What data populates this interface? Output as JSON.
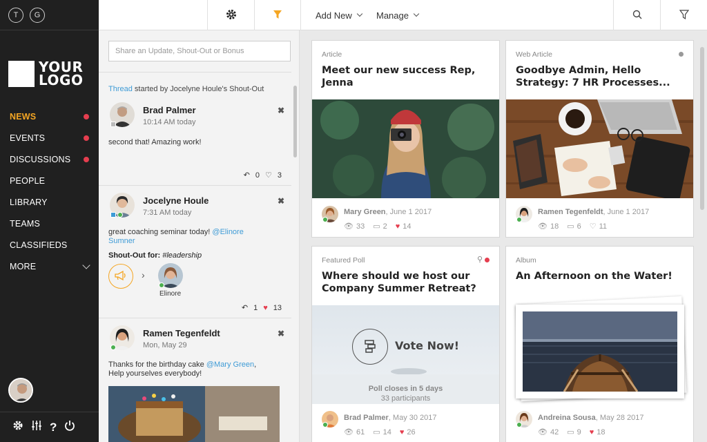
{
  "sidebar": {
    "top_circles": [
      "T",
      "G"
    ],
    "logo_line1": "YOUR",
    "logo_line2": "LOGO",
    "nav": [
      {
        "label": "NEWS",
        "active": true,
        "dot": true
      },
      {
        "label": "EVENTS",
        "dot": true
      },
      {
        "label": "DISCUSSIONS",
        "dot": true
      },
      {
        "label": "PEOPLE"
      },
      {
        "label": "LIBRARY"
      },
      {
        "label": "TEAMS"
      },
      {
        "label": "CLASSIFIEDS"
      },
      {
        "label": "MORE",
        "chevron": true
      }
    ],
    "bottom_icons": [
      "settings-icon",
      "sliders-icon",
      "help-icon",
      "power-icon"
    ]
  },
  "topbar": {
    "settings_icon": "gear-icon",
    "filter_icon": "funnel-icon",
    "add_new": "Add New",
    "manage": "Manage",
    "search_icon": "search-icon",
    "filter2_icon": "funnel-outline-icon",
    "accent": "#f5a623"
  },
  "feed": {
    "share_placeholder": "Share an Update, Shout-Out or Bonus",
    "thread_link": "Thread",
    "thread_text": " started by Jocelyne Houle's Shout-Out",
    "posts": [
      {
        "name": "Brad Palmer",
        "time": "10:14 AM today",
        "body": "second that! Amazing work!",
        "replies": "0",
        "likes": "3"
      },
      {
        "name": "Jocelyne Houle",
        "time": "7:31 AM today",
        "body": "great coaching seminar today! ",
        "mention": "@Elinore Sumner",
        "shout_label": "Shout-Out for: ",
        "shout_tag": "#leadership",
        "recipient": "Elinore",
        "replies": "1",
        "likes": "13"
      },
      {
        "name": "Ramen Tegenfeldt",
        "time": "Mon, May 29",
        "body": "Thanks for the birthday cake ",
        "mention": "@Mary Green",
        "body2": ",",
        "body3": "Help yourselves everybody!"
      }
    ]
  },
  "cards": [
    {
      "type": "Article",
      "title": "Meet our new success Rep, Jenna",
      "author": "Mary Green",
      "date": ", June 1 2017",
      "views": "33",
      "comments": "2",
      "likes": "14"
    },
    {
      "type": "Web Article",
      "title": "Goodbye Admin, Hello Strategy: 7 HR Processes...",
      "author": "Ramen Tegenfeldt",
      "date": ", June 1 2017",
      "views": "18",
      "comments": "6",
      "likes": "11"
    },
    {
      "type": "Featured Poll",
      "title": "Where should we host our Company Summer Retreat?",
      "vote": "Vote Now!",
      "closes": "Poll closes in 5 days",
      "participants": "33 participants",
      "author": "Brad Palmer",
      "date": ", May 30 2017",
      "views": "61",
      "comments": "14",
      "likes": "26"
    },
    {
      "type": "Album",
      "title": "An Afternoon on the Water!",
      "author": "Andreina Sousa",
      "date": ", May 28 2017",
      "views": "42",
      "comments": "9",
      "likes": "18"
    }
  ],
  "colors": {
    "like": "#e53e4f",
    "link": "#3e9bd6",
    "sidebar": "#202020",
    "online": "#4caf50"
  }
}
